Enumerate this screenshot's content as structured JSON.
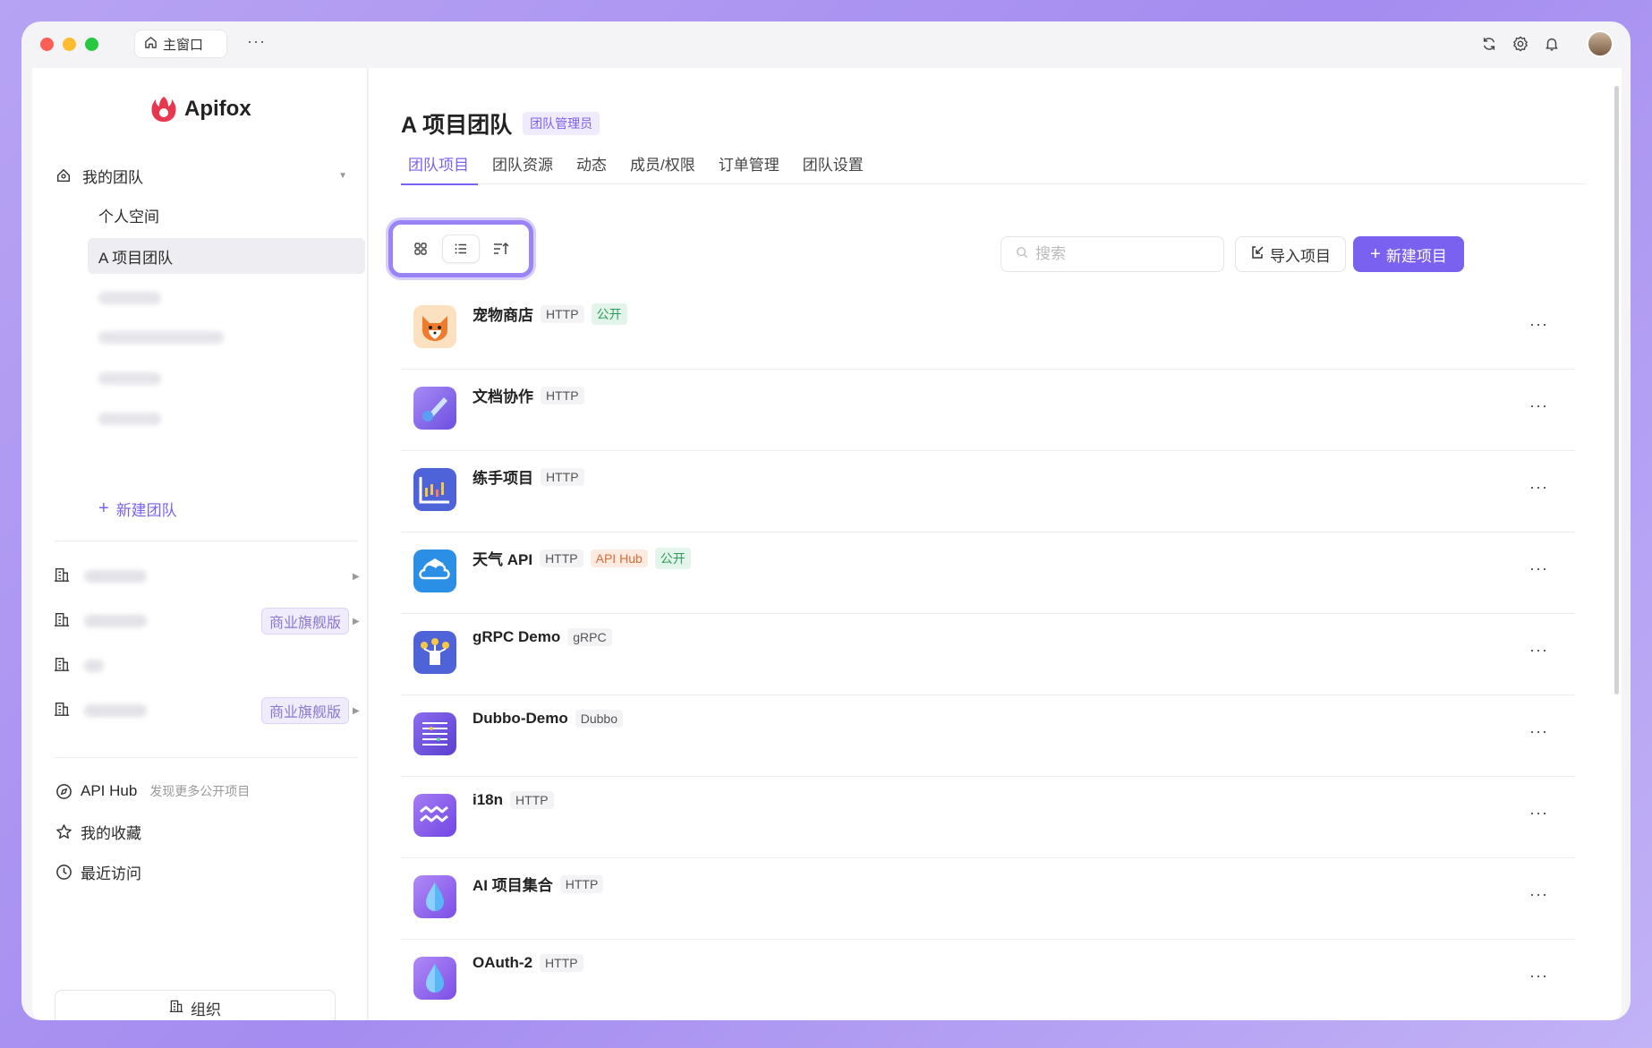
{
  "titlebar": {
    "tab_label": "主窗口",
    "more": "···"
  },
  "sidebar": {
    "logo_text": "Apifox",
    "my_team": "我的团队",
    "teams": [
      {
        "label": "个人空间"
      },
      {
        "label": "A 项目团队"
      }
    ],
    "new_team": "新建团队",
    "org_badge": "商业旗舰版",
    "api_hub": "API Hub",
    "api_hub_hint": "发现更多公开项目",
    "favorites": "我的收藏",
    "recent": "最近访问",
    "org_button": "组织"
  },
  "main": {
    "title": "A 项目团队",
    "role_badge": "团队管理员",
    "tabs": [
      "团队项目",
      "团队资源",
      "动态",
      "成员/权限",
      "订单管理",
      "团队设置"
    ],
    "search_placeholder": "搜索",
    "import_label": "导入项目",
    "new_label": "新建项目",
    "projects": [
      {
        "name": "宠物商店",
        "protocol": "HTTP",
        "tags": [
          "公开"
        ]
      },
      {
        "name": "文档协作",
        "protocol": "HTTP",
        "tags": []
      },
      {
        "name": "练手项目",
        "protocol": "HTTP",
        "tags": []
      },
      {
        "name": "天气 API",
        "protocol": "HTTP",
        "tags": [
          "API Hub",
          "公开"
        ]
      },
      {
        "name": "gRPC Demo",
        "protocol": "gRPC",
        "tags": []
      },
      {
        "name": "Dubbo-Demo",
        "protocol": "Dubbo",
        "tags": []
      },
      {
        "name": "i18n",
        "protocol": "HTTP",
        "tags": []
      },
      {
        "name": "AI 项目集合",
        "protocol": "HTTP",
        "tags": []
      },
      {
        "name": "OAuth-2",
        "protocol": "HTTP",
        "tags": []
      }
    ]
  },
  "colors": {
    "accent": "#7b61f0",
    "public_tag": "#2e9b5a",
    "hub_tag": "#e06a3a"
  }
}
